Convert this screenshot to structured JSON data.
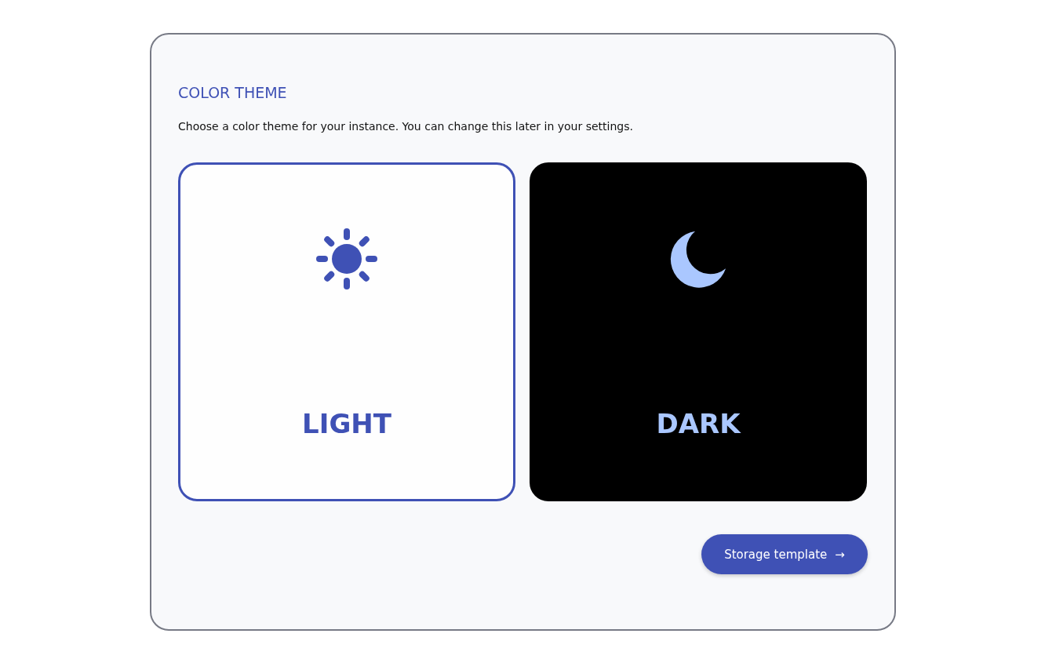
{
  "section": {
    "title": "COLOR THEME",
    "description": "Choose a color theme for your instance. You can change this later in your settings."
  },
  "themes": [
    {
      "kind": "light",
      "label": "LIGHT",
      "selected": true
    },
    {
      "kind": "dark",
      "label": "DARK",
      "selected": false
    }
  ],
  "next_button": {
    "label": "Storage template",
    "icon": "→"
  }
}
